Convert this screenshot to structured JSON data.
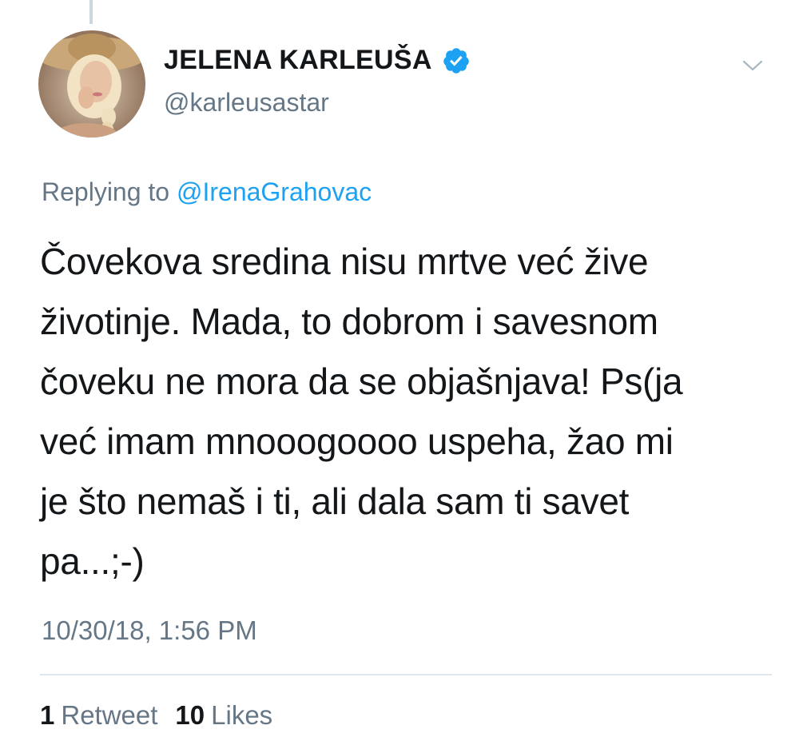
{
  "tweet": {
    "author": {
      "display_name": "JELENA KARLEUŠA",
      "handle": "@karleusastar",
      "verified": true,
      "avatar_icon": "profile-photo"
    },
    "reply": {
      "prefix": "Replying to ",
      "mention": "@IrenaGrahovac"
    },
    "text_lines": [
      "Čovekova sredina nisu mrtve već žive",
      "životinje. Mada, to dobrom i savesnom",
      "čoveku ne mora da se objašnjava! Ps(ja",
      "već imam mnooogoooo uspeha, žao mi",
      "je što nemaš i ti, ali dala sam ti savet",
      "pa...;-)"
    ],
    "timestamp": "10/30/18, 1:56 PM",
    "stats": {
      "retweets_count": "1",
      "retweets_label": "Retweet",
      "likes_count": "10",
      "likes_label": "Likes"
    }
  },
  "colors": {
    "name": "#14171a",
    "secondary": "#657786",
    "link": "#1da1f2",
    "verified": "#1da1f2",
    "divider": "#e1e8ed"
  },
  "icons": {
    "verified": "verified-badge-icon",
    "menu": "chevron-down-icon"
  }
}
